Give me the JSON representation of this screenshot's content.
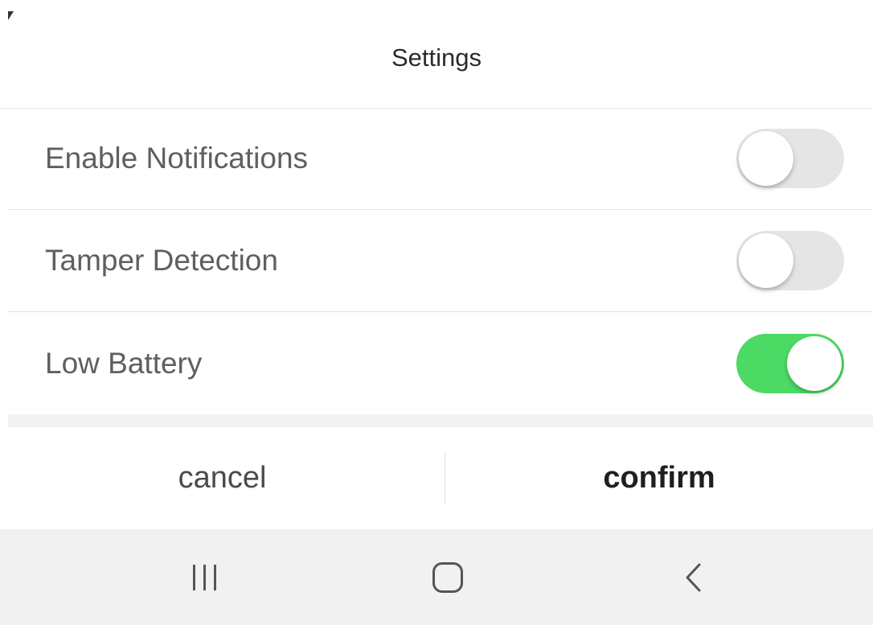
{
  "header": {
    "title": "Settings"
  },
  "settings": {
    "items": [
      {
        "label": "Enable Notifications",
        "enabled": false
      },
      {
        "label": "Tamper Detection",
        "enabled": false
      },
      {
        "label": "Low Battery",
        "enabled": true
      }
    ]
  },
  "actions": {
    "cancel_label": "cancel",
    "confirm_label": "confirm"
  },
  "navbar": {
    "icons": [
      "recent-apps-icon",
      "home-icon",
      "back-icon"
    ]
  },
  "colors": {
    "toggle_on": "#4cd964",
    "toggle_off": "#e5e5e5"
  }
}
